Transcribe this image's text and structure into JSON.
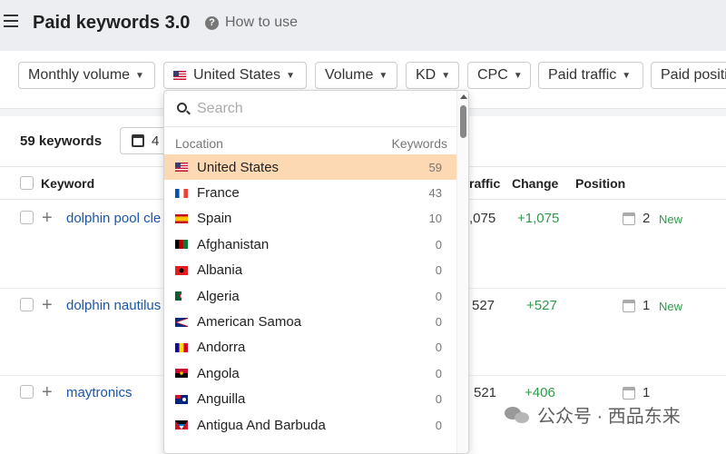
{
  "header": {
    "title": "Paid keywords 3.0",
    "help_text": "How to use"
  },
  "filters": [
    {
      "label": "Monthly volume"
    },
    {
      "label": "United States"
    },
    {
      "label": "Volume"
    },
    {
      "label": "KD"
    },
    {
      "label": "CPC"
    },
    {
      "label": "Paid traffic"
    },
    {
      "label": "Paid positi"
    }
  ],
  "summary": {
    "keyword_count": "59 keywords",
    "date_partial": "4"
  },
  "table": {
    "headers": {
      "keyword": "Keyword",
      "traffic": "raffic",
      "change": "Change",
      "position": "Position"
    },
    "rows": [
      {
        "keyword": "dolphin pool cle",
        "traffic": ",075",
        "change": "+1,075",
        "position": "2",
        "badge": "New"
      },
      {
        "keyword": "dolphin nautilus",
        "traffic": "527",
        "change": "+527",
        "position": "1",
        "badge": "New"
      },
      {
        "keyword": "maytronics",
        "traffic": "521",
        "change": "+406",
        "position": "1",
        "badge": ""
      }
    ]
  },
  "location_dropdown": {
    "search_placeholder": "Search",
    "col_location": "Location",
    "col_keywords": "Keywords",
    "items": [
      {
        "name": "United States",
        "count": "59",
        "flag": "us",
        "selected": true
      },
      {
        "name": "France",
        "count": "43",
        "flag": "fr"
      },
      {
        "name": "Spain",
        "count": "10",
        "flag": "es"
      },
      {
        "name": "Afghanistan",
        "count": "0",
        "flag": "af"
      },
      {
        "name": "Albania",
        "count": "0",
        "flag": "al"
      },
      {
        "name": "Algeria",
        "count": "0",
        "flag": "dz"
      },
      {
        "name": "American Samoa",
        "count": "0",
        "flag": "as"
      },
      {
        "name": "Andorra",
        "count": "0",
        "flag": "ad"
      },
      {
        "name": "Angola",
        "count": "0",
        "flag": "ao"
      },
      {
        "name": "Anguilla",
        "count": "0",
        "flag": "ai"
      },
      {
        "name": "Antigua And Barbuda",
        "count": "0",
        "flag": "ag"
      }
    ]
  },
  "watermark": {
    "text": "公众号 · 西品东来"
  },
  "colors": {
    "selected_bg": "#fcd9b2",
    "link": "#1a56a8",
    "positive": "#2e9b4a"
  }
}
